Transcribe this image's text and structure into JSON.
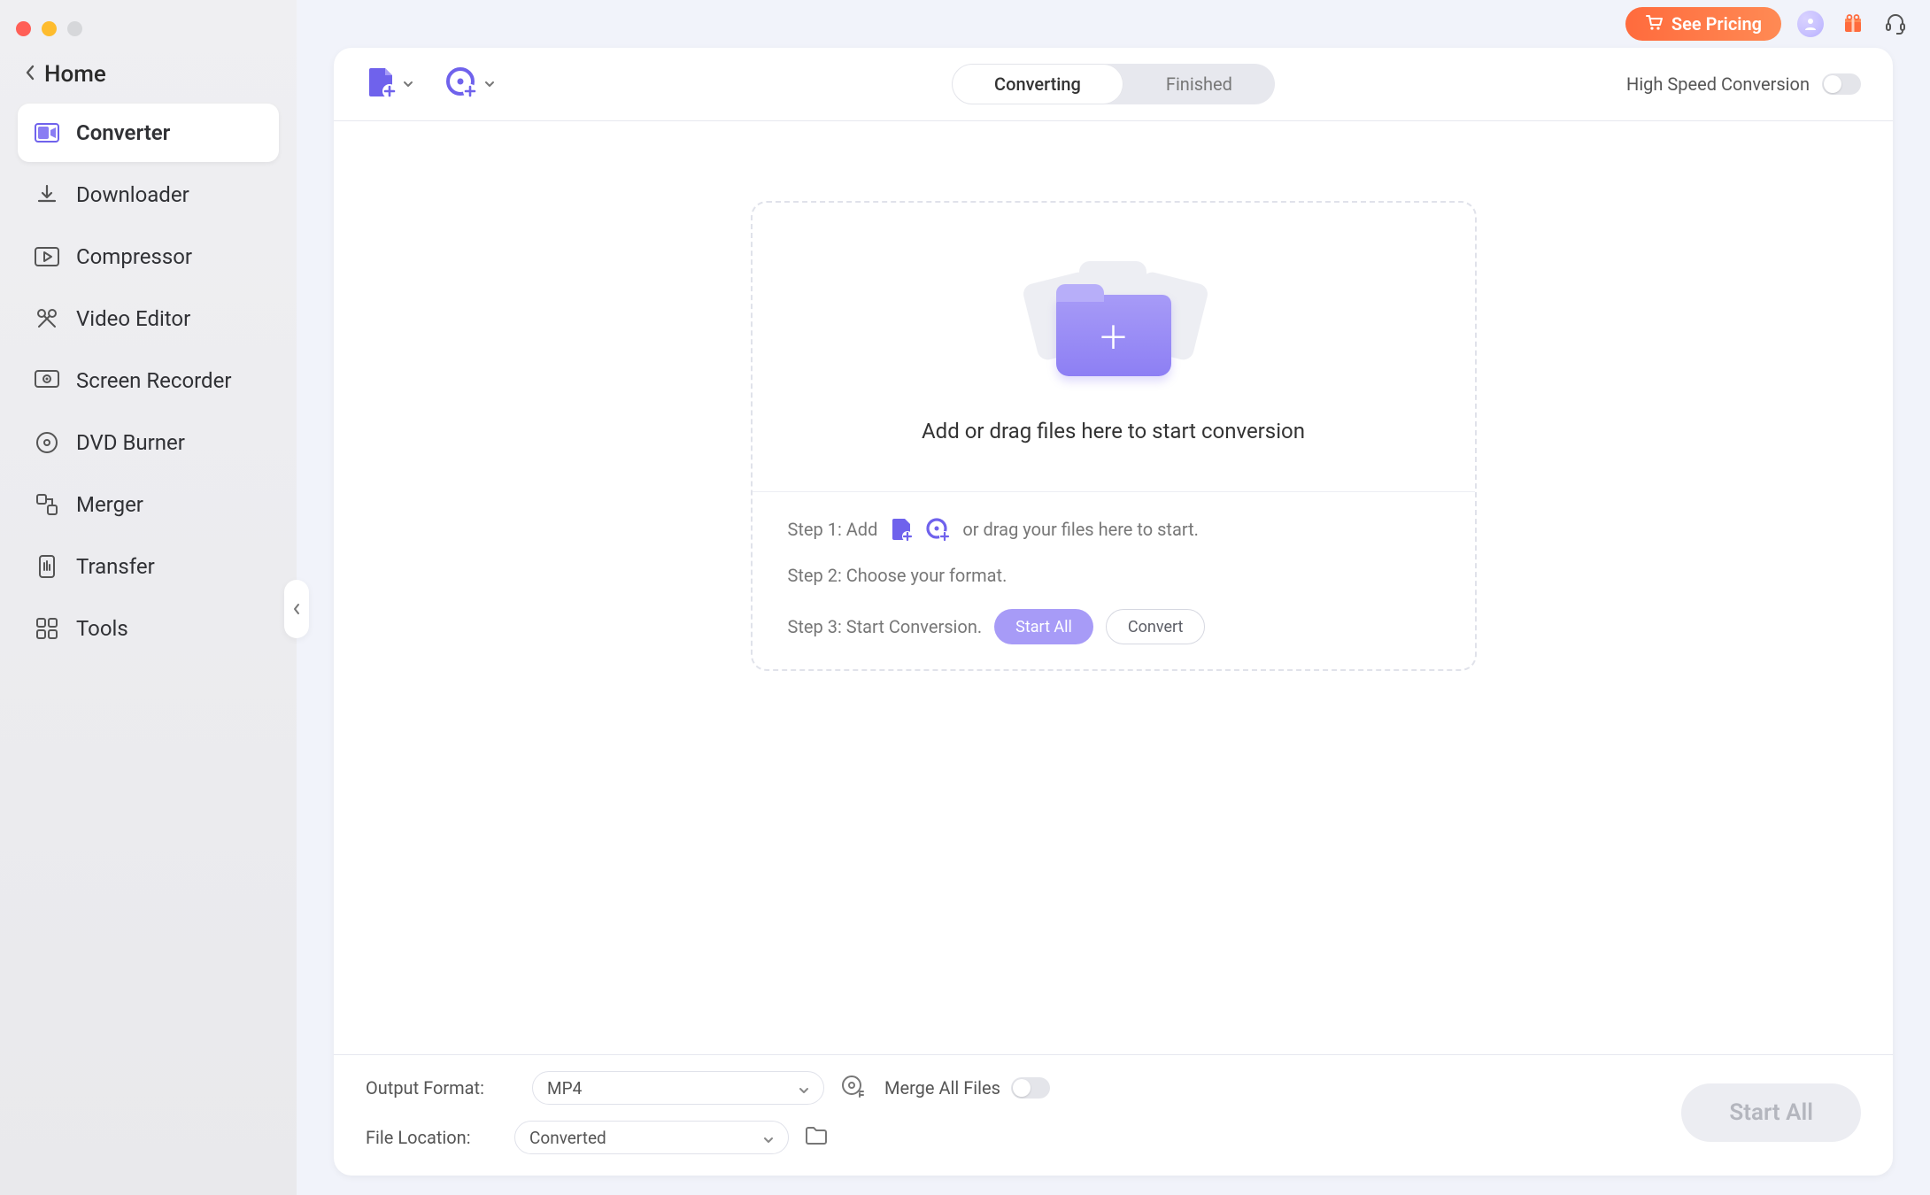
{
  "header": {
    "pricing_label": "See Pricing"
  },
  "sidebar": {
    "home_label": "Home",
    "items": [
      {
        "id": "converter",
        "label": "Converter",
        "active": true
      },
      {
        "id": "downloader",
        "label": "Downloader",
        "active": false
      },
      {
        "id": "compressor",
        "label": "Compressor",
        "active": false
      },
      {
        "id": "video-editor",
        "label": "Video Editor",
        "active": false
      },
      {
        "id": "screen-recorder",
        "label": "Screen Recorder",
        "active": false
      },
      {
        "id": "dvd-burner",
        "label": "DVD Burner",
        "active": false
      },
      {
        "id": "merger",
        "label": "Merger",
        "active": false
      },
      {
        "id": "transfer",
        "label": "Transfer",
        "active": false
      },
      {
        "id": "tools",
        "label": "Tools",
        "active": false
      }
    ]
  },
  "tabs": {
    "converting": "Converting",
    "finished": "Finished",
    "active": "converting"
  },
  "toggle_hispeed": {
    "label": "High Speed Conversion",
    "value": false
  },
  "dropzone": {
    "title": "Add or drag files here to start conversion",
    "step1_prefix": "Step 1: Add",
    "step1_suffix": "or drag your files here to start.",
    "step2": "Step 2: Choose your format.",
    "step3": "Step 3: Start Conversion.",
    "start_all_btn": "Start  All",
    "convert_btn": "Convert"
  },
  "footer": {
    "output_format_label": "Output Format:",
    "output_format_value": "MP4",
    "file_location_label": "File Location:",
    "file_location_value": "Converted",
    "merge_label": "Merge All Files",
    "merge_value": false,
    "start_all_label": "Start All",
    "start_all_enabled": false
  },
  "colors": {
    "accent": "#8076f2",
    "accent_light": "#a79bf7",
    "orange": "#ff6b3d"
  }
}
